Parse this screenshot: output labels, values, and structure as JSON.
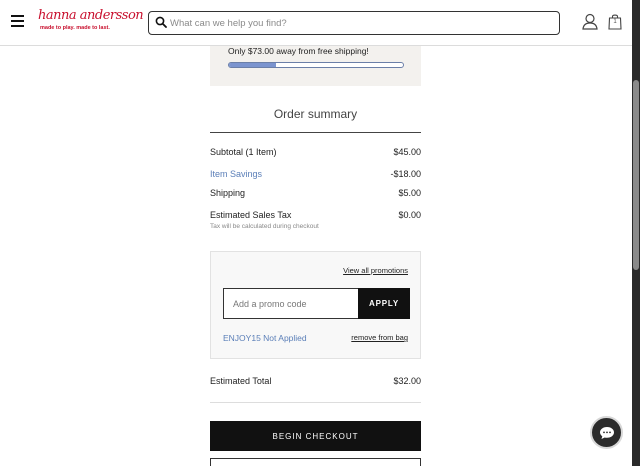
{
  "header": {
    "logo_text": "hanna andersson",
    "logo_tagline": "made to play. made to last.",
    "search_placeholder": "What can we help you find?",
    "bag_count": "1"
  },
  "shipping": {
    "message": "Only $73.00 away from free shipping!",
    "progress_fraction": 0.27
  },
  "summary": {
    "title": "Order summary",
    "rows": [
      {
        "label": "Subtotal (1 Item)",
        "value": "$45.00"
      },
      {
        "label": "Item Savings",
        "value": "-$18.00"
      },
      {
        "label": "Shipping",
        "value": "$5.00"
      },
      {
        "label": "Estimated Sales Tax",
        "value": "$0.00"
      }
    ],
    "tax_note": "Tax will be calculated during checkout",
    "estimated_total_label": "Estimated Total",
    "estimated_total_value": "$32.00"
  },
  "promo": {
    "view_all": "View all promotions",
    "placeholder": "Add a promo code",
    "apply_label": "APPLY",
    "applied_code_status": "ENJOY15 Not Applied",
    "remove_label": "remove from bag"
  },
  "checkout": {
    "begin_label": "BEGIN CHECKOUT"
  },
  "colors": {
    "brand_red": "#c8102e",
    "link_blue": "#5b7fb8",
    "progress_fill": "#7b94cf",
    "panel_bg": "#f3f1ee"
  },
  "icons": {
    "menu": "hamburger-menu-icon",
    "search": "search-icon",
    "account": "account-icon",
    "bag": "shopping-bag-icon",
    "chat": "chat-icon"
  }
}
